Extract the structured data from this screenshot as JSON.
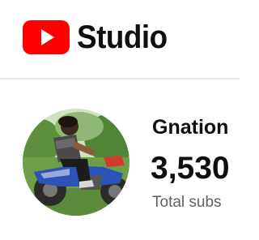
{
  "header": {
    "logo_icon": "youtube-play-icon",
    "logo_text": "Studio",
    "brand_color": "#ff0000"
  },
  "channel": {
    "name": "Gnation",
    "subscriber_count": "3,530",
    "subscriber_label": "Total subs"
  }
}
